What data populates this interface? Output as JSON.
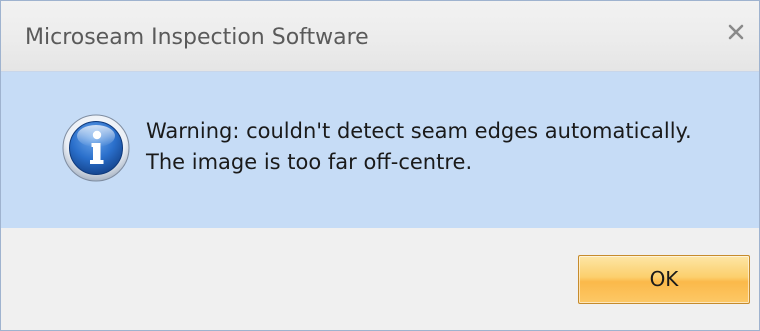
{
  "dialog": {
    "title": "Microseam Inspection Software",
    "close_symbol": "x",
    "close_icon": "close-icon",
    "message_icon": "info-icon",
    "message_lines": [
      "Warning: couldn't detect seam edges automatically.",
      "The image is too far off-centre."
    ],
    "ok_label": "OK"
  },
  "colors": {
    "content_background": "#c6dcf6",
    "button_accent": "#fbb94a",
    "icon_blue": "#1d5fb8"
  }
}
